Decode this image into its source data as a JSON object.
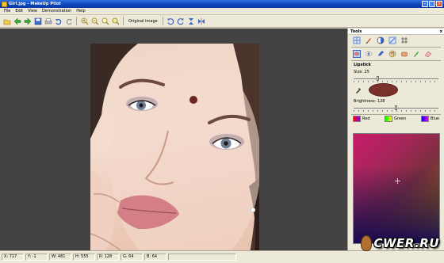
{
  "window": {
    "title": "Girl.jpg - MakeUp Pilot"
  },
  "menu": {
    "items": [
      "File",
      "Edit",
      "View",
      "Demonstration",
      "Help"
    ]
  },
  "toolbar": {
    "original_image_label": "Original image",
    "icons": [
      "open-folder-icon",
      "back-arrow-icon",
      "forward-arrow-icon",
      "save-icon",
      "print-icon",
      "undo-icon",
      "redo-icon",
      "zoom-in-icon",
      "zoom-out-icon",
      "zoom-fit-icon",
      "zoom-actual-icon",
      "rotate-left-icon",
      "rotate-right-icon",
      "flip-vertical-icon",
      "flip-horizontal-icon"
    ]
  },
  "tools_panel": {
    "title": "Tools",
    "close": "x",
    "section_title": "Lipstick",
    "size_label": "Size: 25",
    "size_value": 25,
    "brightness_label": "Brightness: 128",
    "brightness_value": 128,
    "lipstick_color": "#7a302b",
    "channels": [
      {
        "label": "Red"
      },
      {
        "label": "Green"
      },
      {
        "label": "Blue"
      }
    ]
  },
  "status": {
    "x": "X: 717",
    "y": "Y: -1",
    "w": "W: 481",
    "h": "H: 555",
    "r": "R: 128",
    "g": "G: 64",
    "b": "B: 64"
  },
  "watermark": {
    "text": "CWER.RU"
  }
}
